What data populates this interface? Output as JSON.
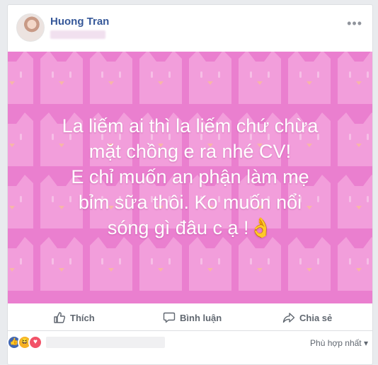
{
  "post": {
    "author": "Huong Tran",
    "text_lines": [
      "La liếm ai thì la liếm chứ chừa",
      "mặt chồng e ra nhé CV!",
      "E chỉ muốn an phận làm mẹ",
      "bỉm sữa thôi. Ko muốn nổi",
      "sóng gì đâu c ạ !👌"
    ],
    "background_color": "#ea7fcf",
    "pattern_color": "#f3a3dd"
  },
  "actions": {
    "like_label": "Thích",
    "comment_label": "Bình luận",
    "share_label": "Chia sẻ"
  },
  "reactions": {
    "types": [
      "like-icon",
      "haha-icon",
      "love-icon"
    ]
  },
  "comments": {
    "sort_label": "Phù hợp nhất"
  },
  "colors": {
    "author_link": "#365899",
    "action_text": "#606770",
    "page_bg": "#e9ebee"
  }
}
